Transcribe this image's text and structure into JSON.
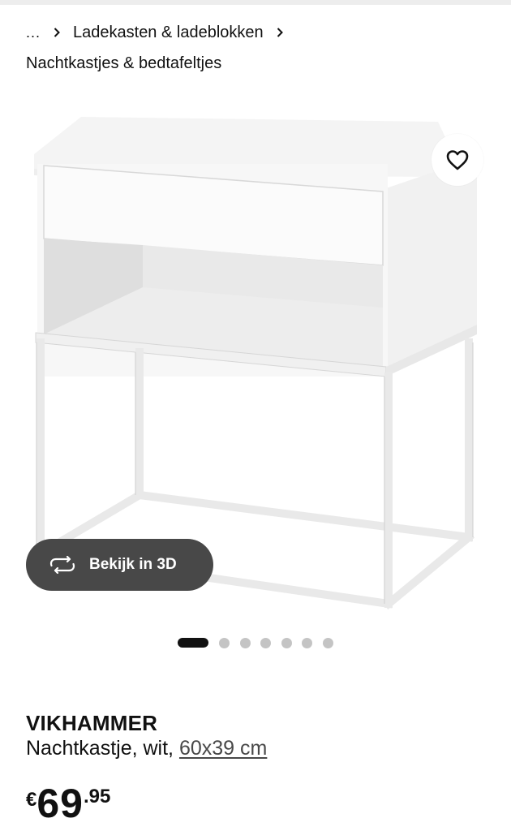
{
  "breadcrumb": {
    "ellipsis": "...",
    "level1": "Ladekasten & ladeblokken",
    "level2": "Nachtkastjes & bedtafeltjes"
  },
  "gallery": {
    "image_alt": "VIKHAMMER nachtkastje wit",
    "view_3d_label": "Bekijk in 3D",
    "total_images": 7,
    "active_index": 0
  },
  "product": {
    "name": "VIKHAMMER",
    "description": "Nachtkastje, wit,",
    "size": "60x39 cm"
  },
  "price": {
    "currency": "€",
    "integer": "69",
    "decimal": ".95"
  },
  "icons": {
    "chevron": "chevron-right-icon",
    "favourite": "heart-icon",
    "rotate_3d": "rotate-3d-icon"
  },
  "colors": {
    "text": "#111111",
    "button_dark": "#484848",
    "dot_inactive": "#c4c4c4",
    "dot_active": "#111111"
  }
}
